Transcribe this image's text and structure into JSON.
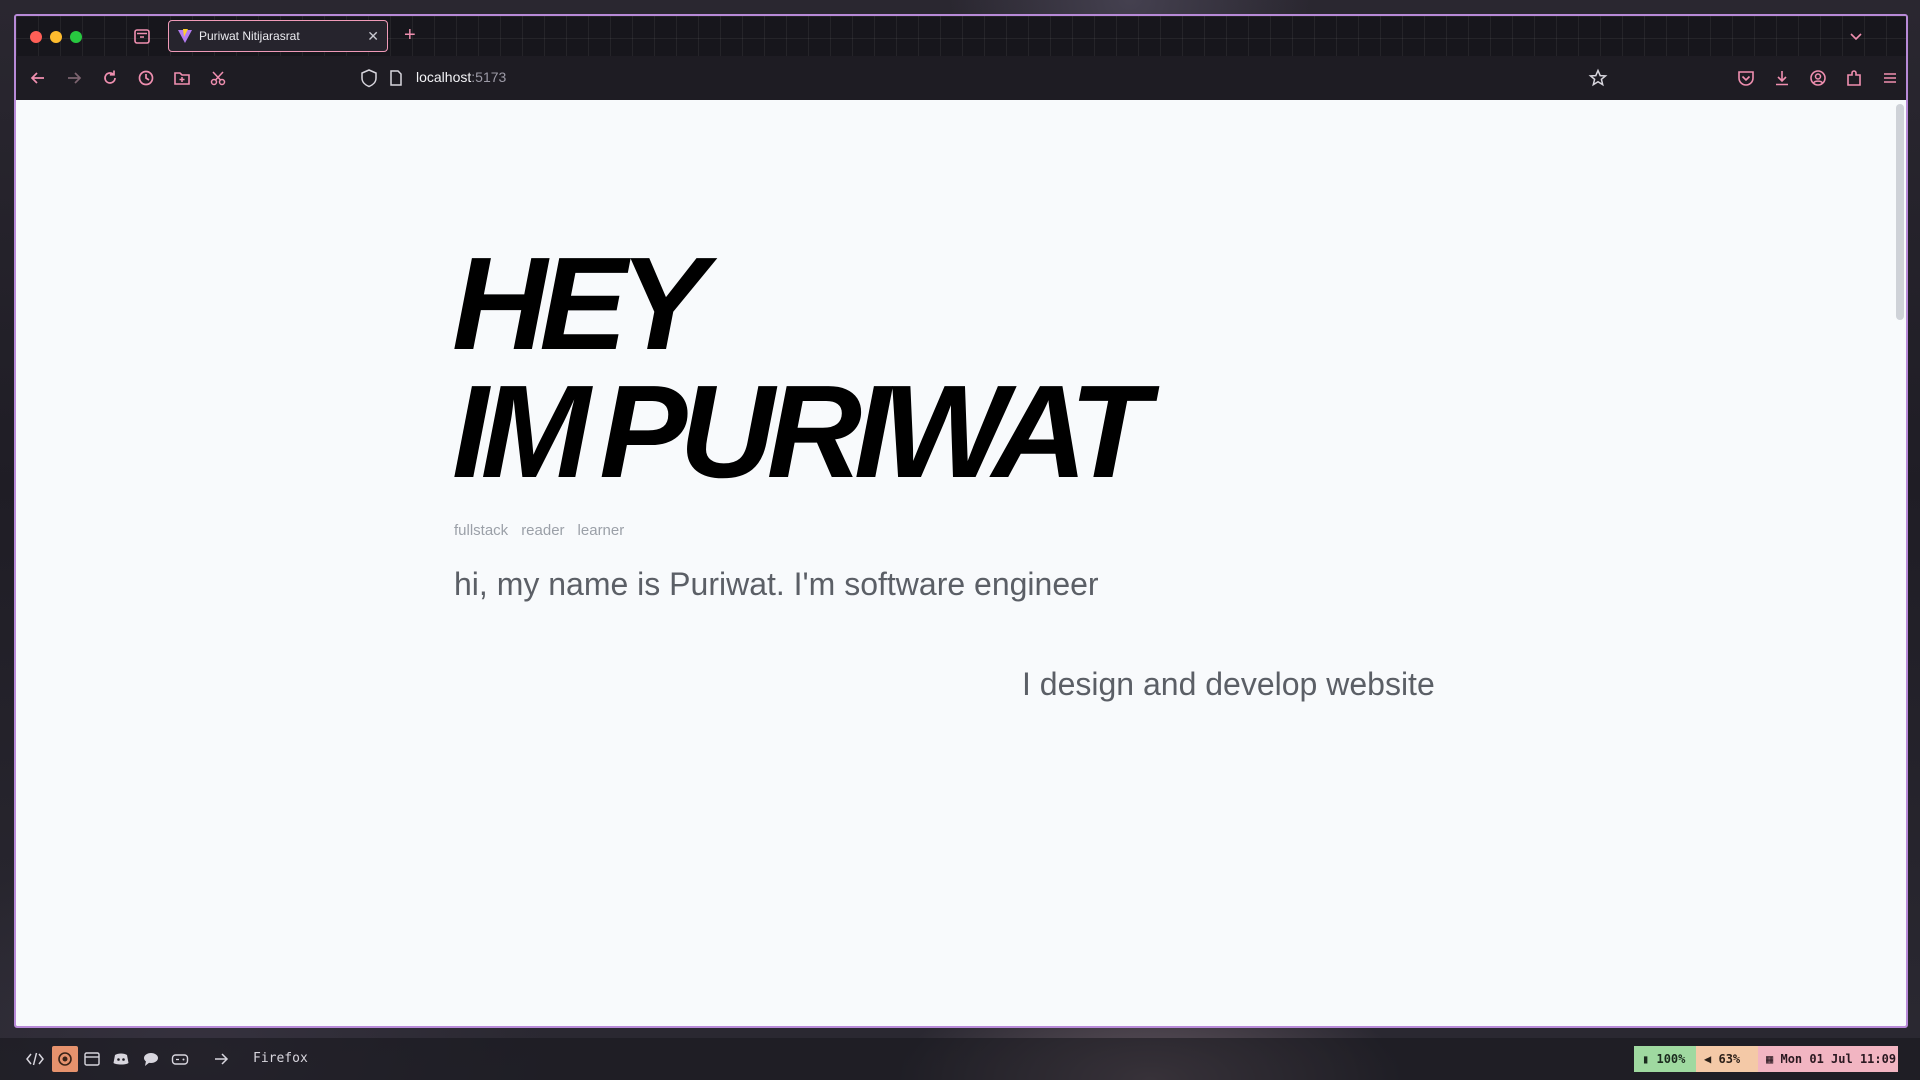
{
  "browser": {
    "tab_title": "Puriwat Nitijarasrat",
    "url_host": "localhost",
    "url_port": ":5173",
    "accent_color": "#f08fb0",
    "border_color": "#b88ad8"
  },
  "toolbar_icons": [
    "back-icon",
    "forward-icon",
    "reload-icon",
    "history-icon",
    "folder-icon",
    "screenshot-icon"
  ],
  "right_toolbar_icons": [
    "pocket-icon",
    "download-icon",
    "account-icon",
    "extensions-icon",
    "menu-icon"
  ],
  "page": {
    "hero_line1": "HEY",
    "hero_line2": "IM PURIWAT",
    "tags": [
      "fullstack",
      "reader",
      "learner"
    ],
    "intro": "hi, my name is Puriwat. I'm software engineer",
    "design": "I design and develop website",
    "background_color": "#f8fafc"
  },
  "taskbar": {
    "app_name": "Firefox",
    "battery": "100%",
    "volume": "63%",
    "clock": "Mon 01 Jul 11:09",
    "icons": [
      "code-icon",
      "firefox-icon",
      "calendar-icon",
      "discord-icon",
      "chat-icon",
      "gamepad-icon",
      "arrow-right-icon"
    ]
  }
}
